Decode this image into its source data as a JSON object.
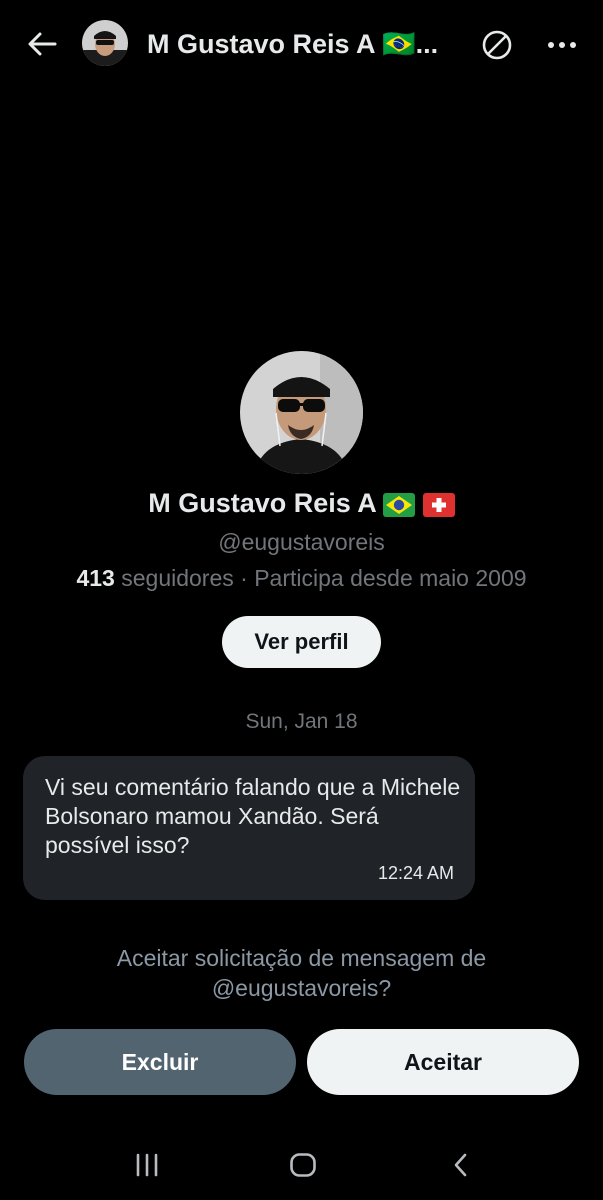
{
  "header": {
    "title": "M Gustavo Reis A 🇧🇷...",
    "back_icon": "arrow-left-icon",
    "block_icon": "block-icon",
    "more_icon": "more-dots-icon"
  },
  "profile": {
    "name": "M Gustavo Reis A",
    "flags": [
      "brazil-flag-icon",
      "switzerland-flag-icon"
    ],
    "handle": "@eugustavoreis",
    "followers_count": "413",
    "followers_label": "seguidores · Participa desde maio 2009",
    "view_profile_label": "Ver perfil"
  },
  "conversation": {
    "date": "Sun, Jan 18",
    "messages": [
      {
        "text": "Vi seu comentário falando que a Michele Bolsonaro mamou Xandão. Será possível isso?",
        "time": "12:24 AM"
      }
    ]
  },
  "request": {
    "prompt": "Aceitar solicitação de mensagem de @eugustavoreis?",
    "delete_label": "Excluir",
    "accept_label": "Aceitar"
  },
  "navbar": {
    "recent_icon": "recent-apps-icon",
    "home_icon": "home-icon",
    "back_icon": "nav-back-icon"
  },
  "colors": {
    "background": "#000000",
    "text_primary": "#e7e9ea",
    "text_secondary": "#71767b",
    "bubble": "#202327",
    "delete_button": "#536471",
    "light_button": "#eff3f4"
  }
}
